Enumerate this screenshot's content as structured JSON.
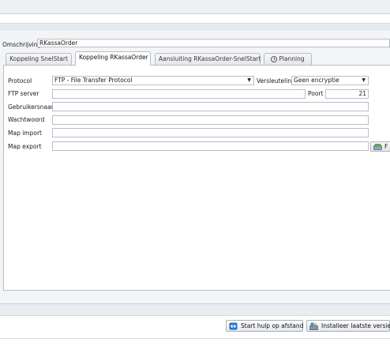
{
  "omschrijving": {
    "label": "Omschrijving",
    "value": "RKassaOrder"
  },
  "tabs": [
    {
      "label": "Koppeling SnelStart"
    },
    {
      "label": "Koppeling RKassaOrder"
    },
    {
      "label": "Aansluiting RKassaOrder-SnelStart"
    },
    {
      "label": "Planning"
    }
  ],
  "form": {
    "protocol": {
      "label": "Protocol",
      "value": "FTP - File Transfer Protocol"
    },
    "versleuteling": {
      "label": "Versleuteling",
      "value": "Geen encryptie"
    },
    "ftp_server": {
      "label": "FTP server",
      "value": ""
    },
    "poort": {
      "label": "Poort",
      "value": "21"
    },
    "gebruikersnaam": {
      "label": "Gebruikersnaam",
      "value": ""
    },
    "wachtwoord": {
      "label": "Wachtwoord",
      "value": ""
    },
    "map_import": {
      "label": "Map import",
      "value": ""
    },
    "map_export": {
      "label": "Map export",
      "value": ""
    },
    "browse_button_label": "F"
  },
  "footer": {
    "remote_help_label": "Start hulp op afstand",
    "install_label": "Installeer laatste versie"
  },
  "icons": {
    "tab_planning": "clock-icon",
    "browse": "drive-icon",
    "remote_help": "remote-help-icon",
    "install": "install-icon"
  }
}
